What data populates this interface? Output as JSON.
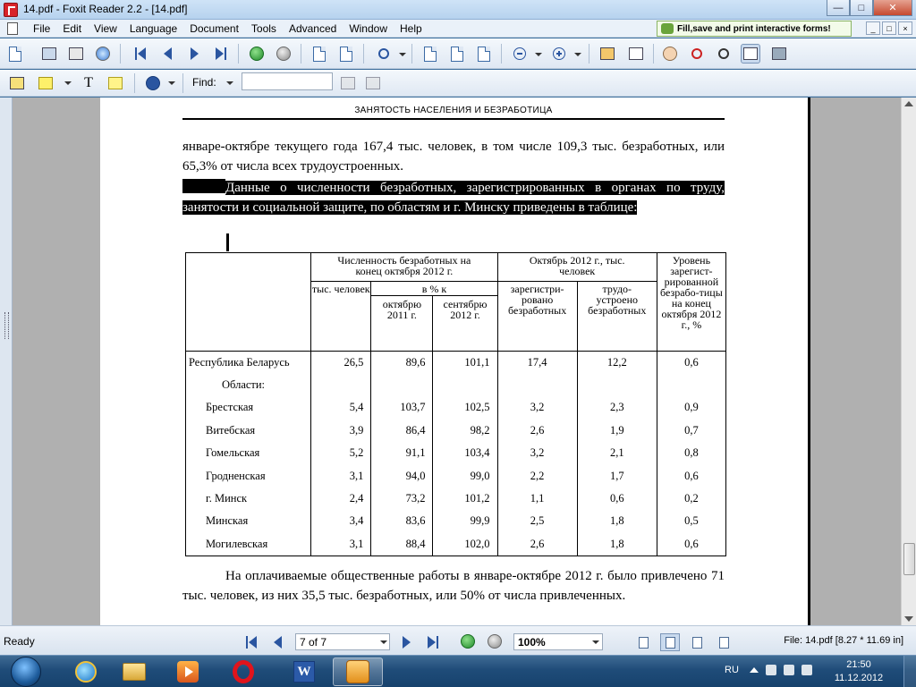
{
  "window": {
    "title": "14.pdf - Foxit Reader 2.2 - [14.pdf]",
    "min_glyph": "—",
    "max_glyph": "□",
    "close_glyph": "✕"
  },
  "menu": {
    "items": [
      "File",
      "Edit",
      "View",
      "Language",
      "Document",
      "Tools",
      "Advanced",
      "Window",
      "Help"
    ],
    "promo": "Fill,save and print interactive forms!",
    "mdi_glyphs": [
      "_",
      "□",
      "×"
    ]
  },
  "toolbar2": {
    "find_label": "Find:",
    "find_value": ""
  },
  "document": {
    "running_head": "ЗАНЯТОСТЬ НАСЕЛЕНИЯ  И БЕЗРАБОТИЦА",
    "para1": "январе-октябре текущего года 167,4 тыс. человек, в том числе 109,3 тыс. безработных, или 65,3% от числа всех трудоустроенных.",
    "para2": "Данные о численности безработных, зарегистрированных в органах по труду, занятости и социальной защите, по областям и г. Минску приведены в таблице:",
    "para3": "На оплачиваемые общественные работы в январе-октябре 2012 г. было привлечено 71 тыс. человек, из них 35,5 тыс. безработных, или 50% от числа привлеченных.",
    "table": {
      "h_group1": "Численность безработных на конец октября 2012 г.",
      "h_group2": "Октябрь 2012 г., тыс. человек",
      "h_level": "Уровень зарегист-рированной безрабо-тицы на конец октября 2012 г., %",
      "h_thous": "тыс. человек",
      "h_pct": "в % к",
      "h_oct2011": "октябрю 2011 г.",
      "h_sep2012": "сентябрю 2012 г.",
      "h_registered": "зарегистри-ровано безработных",
      "h_employed": "трудо-устроено безработных",
      "rows": [
        {
          "label": "Республика Беларусь",
          "indent": 0,
          "v": [
            "26,5",
            "89,6",
            "101,1",
            "17,4",
            "12,2",
            "0,6"
          ]
        },
        {
          "label": "Области:",
          "indent": 2,
          "v": [
            "",
            "",
            "",
            "",
            "",
            ""
          ]
        },
        {
          "label": "Брестская",
          "indent": 1,
          "v": [
            "5,4",
            "103,7",
            "102,5",
            "3,2",
            "2,3",
            "0,9"
          ]
        },
        {
          "label": "Витебская",
          "indent": 1,
          "v": [
            "3,9",
            "86,4",
            "98,2",
            "2,6",
            "1,9",
            "0,7"
          ]
        },
        {
          "label": "Гомельская",
          "indent": 1,
          "v": [
            "5,2",
            "91,1",
            "103,4",
            "3,2",
            "2,1",
            "0,8"
          ]
        },
        {
          "label": "Гродненская",
          "indent": 1,
          "v": [
            "3,1",
            "94,0",
            "99,0",
            "2,2",
            "1,7",
            "0,6"
          ]
        },
        {
          "label": "г. Минск",
          "indent": 1,
          "v": [
            "2,4",
            "73,2",
            "101,2",
            "1,1",
            "0,6",
            "0,2"
          ]
        },
        {
          "label": "Минская",
          "indent": 1,
          "v": [
            "3,4",
            "83,6",
            "99,9",
            "2,5",
            "1,8",
            "0,5"
          ]
        },
        {
          "label": "Могилевская",
          "indent": 1,
          "v": [
            "3,1",
            "88,4",
            "102,0",
            "2,6",
            "1,8",
            "0,6"
          ]
        }
      ]
    }
  },
  "statusbar": {
    "ready": "Ready",
    "page": "7 of 7",
    "zoom": "100%",
    "fileinfo": "File: 14.pdf [8.27 * 11.69 in]"
  },
  "taskbar": {
    "lang": "RU",
    "time": "21:50",
    "date": "11.12.2012",
    "word_glyph": "W"
  },
  "colors": {
    "titlebar": "#cfe3f7",
    "taskbar": "#1f4c79",
    "highlight": "#000000"
  }
}
